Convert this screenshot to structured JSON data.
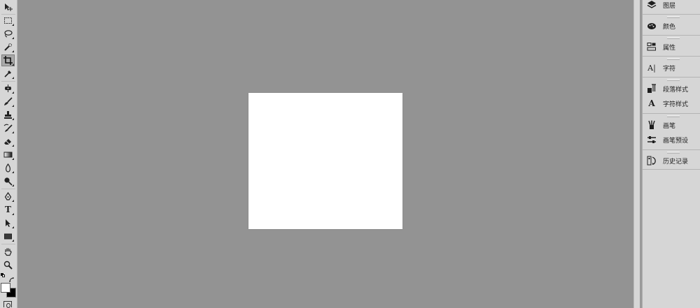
{
  "toolbar": {
    "tools": [
      {
        "icon": "move-icon"
      },
      {
        "icon": "marquee-icon"
      },
      {
        "icon": "lasso-icon"
      },
      {
        "icon": "quick-selection-icon"
      },
      {
        "icon": "crop-icon",
        "active": true
      },
      {
        "icon": "eyedropper-icon"
      },
      {
        "icon": "spot-healing-icon"
      },
      {
        "icon": "brush-icon"
      },
      {
        "icon": "clone-stamp-icon"
      },
      {
        "icon": "history-brush-icon"
      },
      {
        "icon": "eraser-icon"
      },
      {
        "icon": "gradient-icon"
      },
      {
        "icon": "blur-icon"
      },
      {
        "icon": "dodge-icon"
      },
      {
        "icon": "pen-icon"
      },
      {
        "icon": "type-icon",
        "glyph": "T"
      },
      {
        "icon": "path-selection-icon"
      },
      {
        "icon": "rectangle-icon"
      },
      {
        "icon": "hand-icon"
      },
      {
        "icon": "zoom-icon"
      }
    ],
    "foreground_color": "#ffffff",
    "background_color": "#000000"
  },
  "document": {
    "fill": "#ffffff"
  },
  "panels": {
    "groups": [
      {
        "items": [
          {
            "icon": "layers-icon",
            "label": "图层"
          }
        ]
      },
      {
        "items": [
          {
            "icon": "color-palette-icon",
            "label": "颜色"
          }
        ]
      },
      {
        "items": [
          {
            "icon": "properties-icon",
            "label": "属性"
          }
        ]
      },
      {
        "items": [
          {
            "icon": "character-icon",
            "label": "字符",
            "glyph": "A|"
          }
        ]
      },
      {
        "items": [
          {
            "icon": "paragraph-styles-icon",
            "label": "段落样式"
          },
          {
            "icon": "character-styles-icon",
            "label": "字符样式",
            "glyph": "A"
          }
        ]
      },
      {
        "items": [
          {
            "icon": "brush-panel-icon",
            "label": "画笔"
          },
          {
            "icon": "brush-presets-icon",
            "label": "画笔预设"
          }
        ]
      },
      {
        "items": [
          {
            "icon": "history-icon",
            "label": "历史记录"
          }
        ]
      }
    ]
  }
}
